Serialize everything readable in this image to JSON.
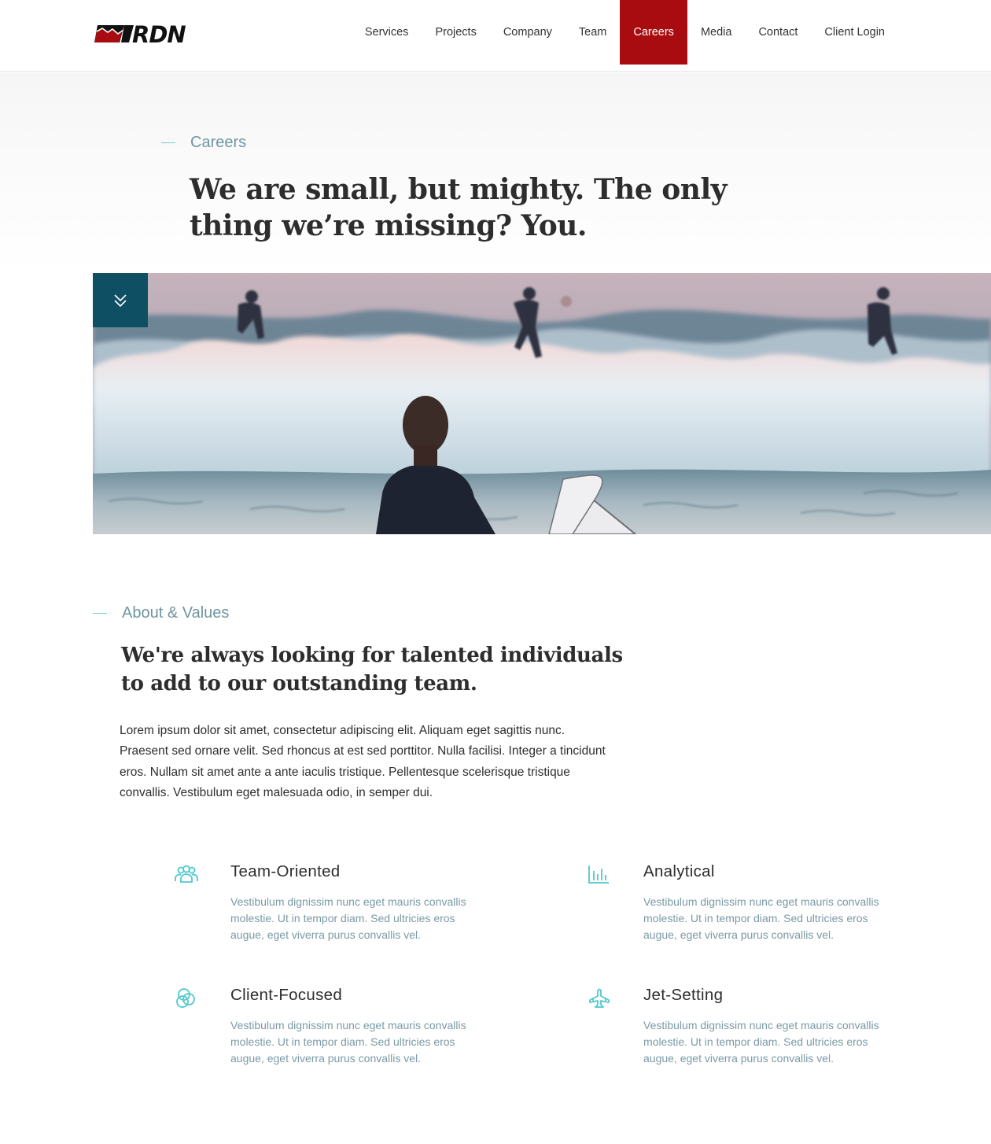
{
  "brand": {
    "name": "RDN",
    "accent": "#a80c10",
    "teal": "#0f4f64",
    "icon_color": "#4fc9cf"
  },
  "nav": {
    "items": [
      {
        "label": "Services",
        "active": false
      },
      {
        "label": "Projects",
        "active": false
      },
      {
        "label": "Company",
        "active": false
      },
      {
        "label": "Team",
        "active": false
      },
      {
        "label": "Careers",
        "active": true
      },
      {
        "label": "Media",
        "active": false
      },
      {
        "label": "Contact",
        "active": false
      },
      {
        "label": "Client Login",
        "active": false
      }
    ]
  },
  "hero": {
    "eyebrow": "Careers",
    "title": "We are small, but mighty. The only thing we’re missing? You.",
    "image_alt": "Surfer holding a board watching waves with surfers riding at sunset",
    "scroll_icon": "double-chevron-down-icon"
  },
  "about": {
    "eyebrow": "About & Values",
    "title": "We're always looking for talented individuals to add to our outstanding team.",
    "body": "Lorem ipsum dolor sit amet, consectetur adipiscing elit. Aliquam eget sagittis nunc. Praesent sed ornare velit. Sed rhoncus at est sed porttitor. Nulla facilisi. Integer a tincidunt eros. Nullam sit amet ante a ante iaculis tristique. Pellentesque scelerisque tristique convallis. Vestibulum eget malesuada odio, in semper dui."
  },
  "values": [
    {
      "icon": "team-icon",
      "title": "Team-Oriented",
      "description": "Vestibulum dignissim nunc eget mauris convallis molestie. Ut in tempor diam. Sed ultricies eros augue, eget viverra purus convallis vel."
    },
    {
      "icon": "bar-chart-icon",
      "title": "Analytical",
      "description": "Vestibulum dignissim nunc eget mauris convallis molestie. Ut in tempor diam. Sed ultricies eros augue, eget viverra purus convallis vel."
    },
    {
      "icon": "overlapping-circles-icon",
      "title": "Client-Focused",
      "description": "Vestibulum dignissim nunc eget mauris convallis molestie. Ut in tempor diam. Sed ultricies eros augue, eget viverra purus convallis vel."
    },
    {
      "icon": "jet-icon",
      "title": "Jet-Setting",
      "description": "Vestibulum dignissim nunc eget mauris convallis molestie. Ut in tempor diam. Sed ultricies eros augue, eget viverra purus convallis vel."
    }
  ]
}
